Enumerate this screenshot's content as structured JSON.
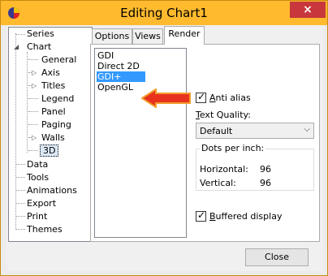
{
  "window": {
    "title": "Editing Chart1",
    "close_symbol": "×"
  },
  "tree": {
    "items": [
      {
        "label": "Series"
      },
      {
        "label": "Chart",
        "expanded": true
      },
      {
        "label": "General"
      },
      {
        "label": "Axis",
        "has_children": true
      },
      {
        "label": "Titles",
        "has_children": true
      },
      {
        "label": "Legend"
      },
      {
        "label": "Panel"
      },
      {
        "label": "Paging"
      },
      {
        "label": "Walls",
        "has_children": true
      },
      {
        "label": "3D",
        "selected": true
      },
      {
        "label": "Data"
      },
      {
        "label": "Tools"
      },
      {
        "label": "Animations"
      },
      {
        "label": "Export"
      },
      {
        "label": "Print"
      },
      {
        "label": "Themes"
      }
    ]
  },
  "tabs": [
    {
      "label": "Options"
    },
    {
      "label": "Views"
    },
    {
      "label": "Render",
      "active": true
    }
  ],
  "render": {
    "renderers": [
      "GDI",
      "Direct 2D",
      "GDI+",
      "OpenGL"
    ],
    "selected_renderer": "GDI+",
    "anti_alias": {
      "label_prefix": "",
      "label_underlined": "A",
      "label_rest": "nti alias",
      "checked": true
    },
    "text_quality": {
      "label_underlined": "T",
      "label_rest": "ext Quality:",
      "value": "Default"
    },
    "dots_per_inch": {
      "title": "Dots per inch:",
      "horizontal_label": "Horizontal:",
      "horizontal_value": "96",
      "vertical_label": "Vertical:",
      "vertical_value": "96"
    },
    "buffered": {
      "label_underlined": "B",
      "label_rest": "uffered display",
      "checked": true
    }
  },
  "footer": {
    "close_label": "Close"
  },
  "colors": {
    "titlebar": "#ffba2e",
    "selection": "#3399ff",
    "annotation_arrow": "#e8321e"
  }
}
